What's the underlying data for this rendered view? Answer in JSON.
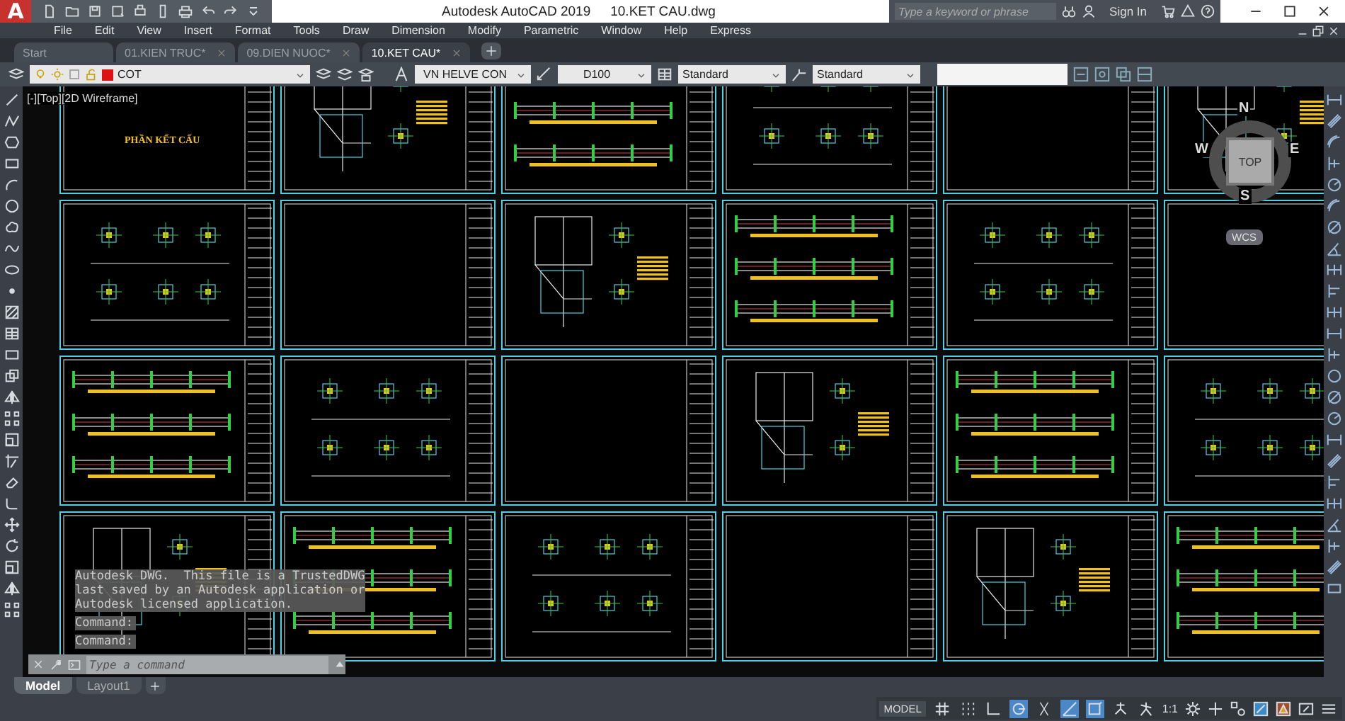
{
  "title_bar": {
    "app_logo": "A",
    "app_name": "Autodesk AutoCAD 2019",
    "file_name": "10.KET CAU.dwg",
    "search": {
      "placeholder": "Type a keyword or phrase"
    },
    "sign_in": "Sign In"
  },
  "menu": [
    "File",
    "Edit",
    "View",
    "Insert",
    "Format",
    "Tools",
    "Draw",
    "Dimension",
    "Modify",
    "Parametric",
    "Window",
    "Help",
    "Express"
  ],
  "file_tabs": [
    {
      "label": "Start",
      "selected": false,
      "closable": false
    },
    {
      "label": "01.KIEN TRUC*",
      "selected": false,
      "closable": true
    },
    {
      "label": "09.DIEN NUOC*",
      "selected": false,
      "closable": true
    },
    {
      "label": "10.KET CAU*",
      "selected": true,
      "closable": true
    }
  ],
  "properties_toolbar": {
    "layer": "COT",
    "text_style": "VN HELVE CON",
    "dim_style": "D100",
    "table_style": "Standard",
    "multileader_style": "Standard"
  },
  "viewport": {
    "label": "[-][Top][2D Wireframe]",
    "drawing_title": "PHẦN KẾT CẤU"
  },
  "viewcube": {
    "north": "N",
    "east": "E",
    "south": "S",
    "west": "W",
    "face": "TOP",
    "ucs": "WCS"
  },
  "command_line": {
    "history": [
      "Autodesk DWG.  This file is a TrustedDWG",
      "last saved by an Autodesk application or",
      "Autodesk licensed application.",
      "Command:",
      "Command:"
    ],
    "placeholder": "Type a command"
  },
  "layout_tabs": [
    {
      "label": "Model",
      "selected": true
    },
    {
      "label": "Layout1",
      "selected": false
    }
  ],
  "status_bar": {
    "mode": "MODEL",
    "scale": "1:1",
    "toggles": [
      {
        "on": false
      },
      {
        "on": false
      },
      {
        "on": false
      },
      {
        "on": true
      },
      {
        "on": false
      },
      {
        "on": true
      },
      {
        "on": true
      },
      {
        "on": false
      },
      {
        "on": false
      }
    ]
  }
}
